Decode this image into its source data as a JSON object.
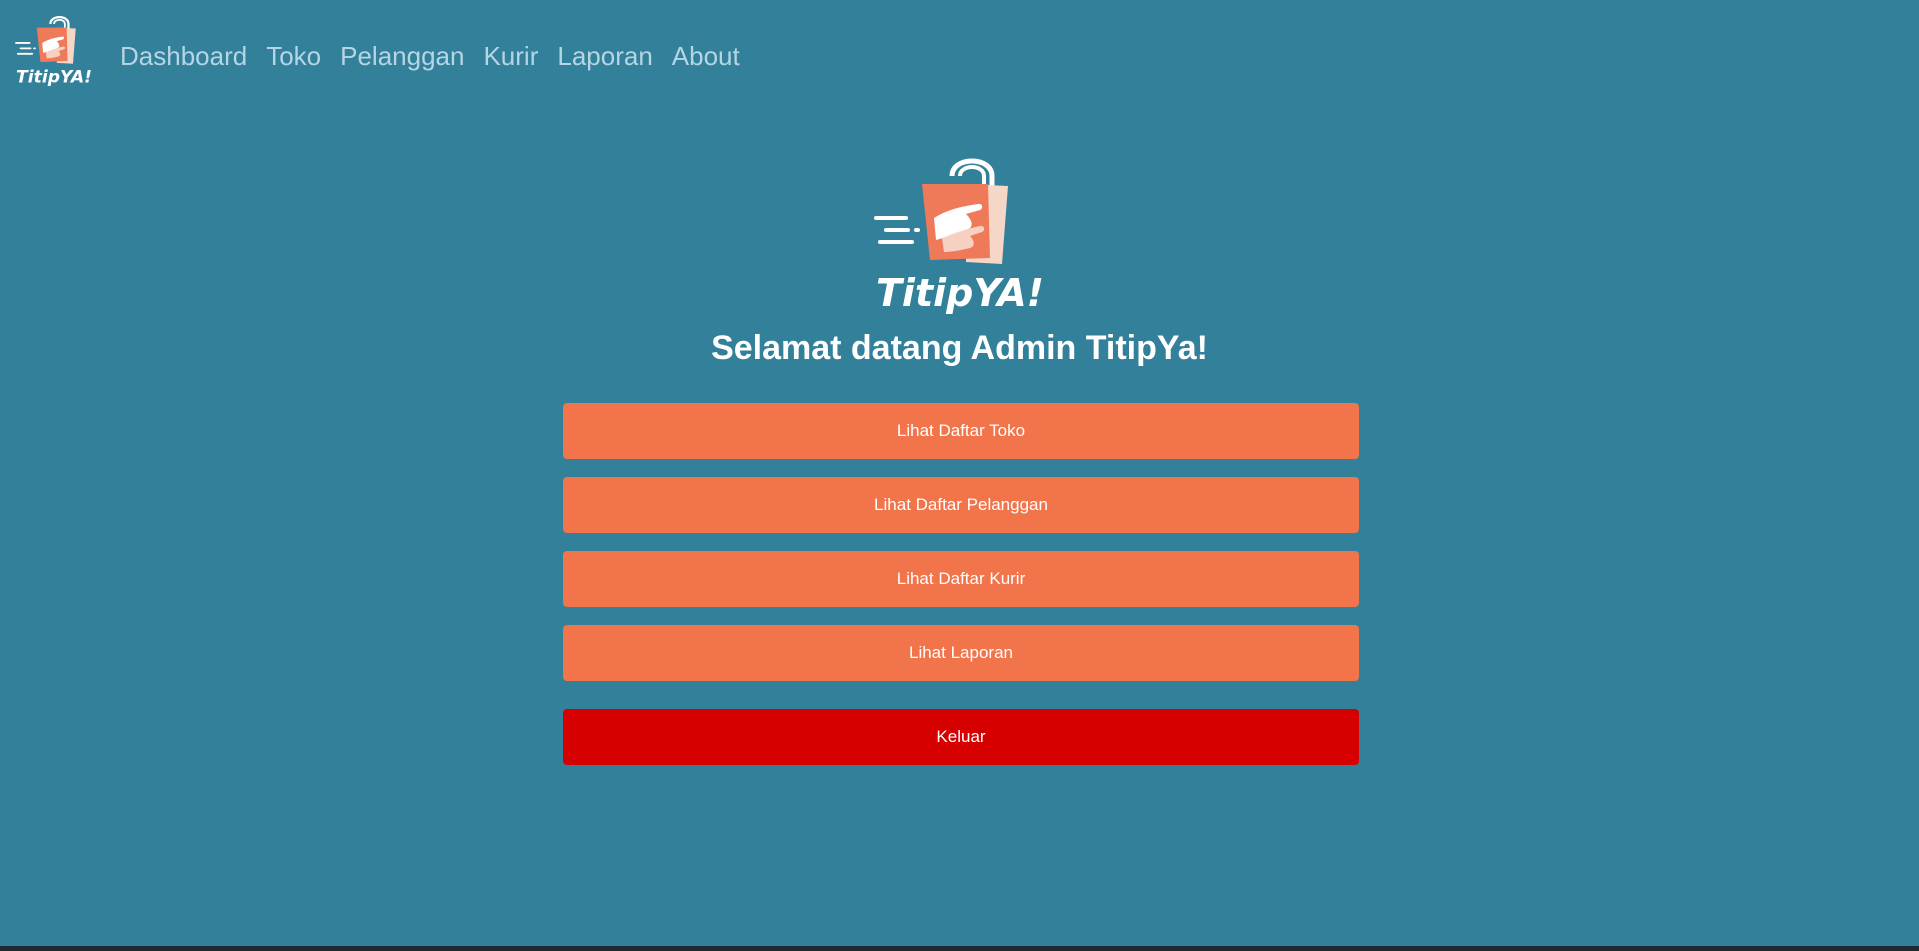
{
  "brand": {
    "name": "TitipYA!",
    "bag_color": "#ef7a5a",
    "bag_back_color": "#f6d6c7"
  },
  "nav": {
    "links": [
      "Dashboard",
      "Toko",
      "Pelanggan",
      "Kurir",
      "Laporan",
      "About"
    ]
  },
  "hero": {
    "welcome_text": "Selamat datang Admin TitipYa!"
  },
  "actions": {
    "list_stores": "Lihat Daftar Toko",
    "list_customers": "Lihat Daftar Pelanggan",
    "list_couriers": "Lihat Daftar Kurir",
    "view_reports": "Lihat Laporan",
    "logout": "Keluar"
  },
  "colors": {
    "background": "#32809a",
    "nav_text": "#b6d5e4",
    "action_button": "#f1744a",
    "logout_button": "#d60000"
  }
}
